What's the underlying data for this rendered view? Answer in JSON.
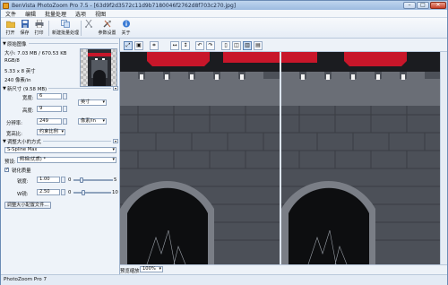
{
  "window": {
    "title": "BenVista PhotoZoom Pro 7.5 - [63d9f2d3572c11d9b7180046f2762d8f703c270.jpg]",
    "minimize": "–",
    "maximize": "□",
    "close": "✕"
  },
  "menu": [
    "文件",
    "编辑",
    "批量处理",
    "选项",
    "视图"
  ],
  "toolbar": {
    "open": "打开",
    "save": "保存",
    "print": "打印",
    "batch": "新建批量处理",
    "settings": "参数设置",
    "about": "关于"
  },
  "original_image": {
    "header": "原始图像",
    "size_line": "大小: 7.03 MB / 670.53 KB",
    "mode": "RGB/8",
    "dimensions": "5.33 x 8 英寸",
    "resolution": "240 像素/in"
  },
  "new_size": {
    "header": "新尺寸 (9.58 MB)",
    "width_label": "宽度:",
    "width_value": "6",
    "height_label": "高度:",
    "height_value": "9",
    "unit": "英寸",
    "resolution_label": "分辨率:",
    "resolution_value": "249",
    "resolution_unit": "像素/in",
    "aspect_label": "宽高比:",
    "aspect_value": "约束比例"
  },
  "resize_method": {
    "header": "调整大小的方式",
    "method": "S-Spline Max",
    "preset_label": "预设:",
    "preset_value": "照相(优质) *",
    "sharpen_label": "锐化质量",
    "sharpen_checked": true,
    "clarity_label": "锐度:",
    "clarity_value": "1.00",
    "clarity_min": "0",
    "clarity_max": "5",
    "clarity_level": 0.2,
    "depth_label": "W锐:",
    "depth_value": "2.50",
    "depth_min": "0",
    "depth_max": "10",
    "depth_level": 0.25,
    "batch_button": "调整大小配置文件..."
  },
  "preview": {
    "zoom_label": "预览缩放:",
    "zoom_value": "100%"
  },
  "status": "PhotoZoom Pro 7",
  "colors": {
    "accent": "#4a78b5",
    "roof_red": "#c8162a",
    "stone": "#5a5e66"
  }
}
